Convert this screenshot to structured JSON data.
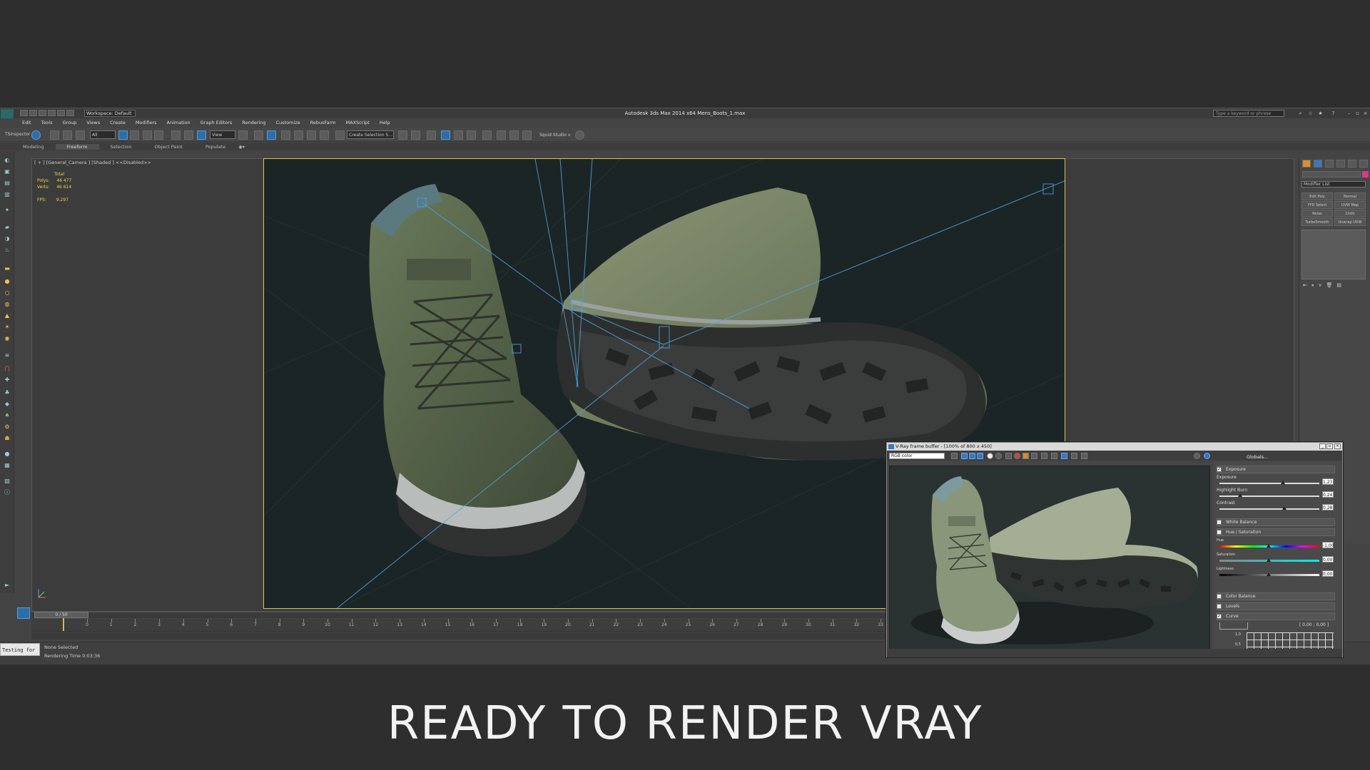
{
  "app": {
    "title": "Autodesk 3ds Max  2014 x64    Mens_Boots_1.max",
    "workspace": "Workspace: Default",
    "search_placeholder": "Type a keyword or phrase",
    "side_label": "TSInspector"
  },
  "menu": [
    "Edit",
    "Tools",
    "Group",
    "Views",
    "Create",
    "Modifiers",
    "Animation",
    "Graph Editors",
    "Rendering",
    "Customize",
    "RebusFarm",
    "MAXScript",
    "Help"
  ],
  "toolbar": {
    "selection_filter": "All",
    "ref_coord": "View",
    "named_selection": "Create Selection S...",
    "plugin_label": "Squid Studio v"
  },
  "ribbon_tabs": [
    "Modeling",
    "Freeform",
    "Selection",
    "Object Paint",
    "Populate"
  ],
  "viewport": {
    "label": "[ + ] [General_Camera ] [Shaded ]  <<Disabled>>",
    "stats_header": "Total",
    "polys_label": "Polys:",
    "polys_value": "46 477",
    "verts_label": "Verts:",
    "verts_value": "46 614",
    "fps_label": "FPS:",
    "fps_value": "9,297"
  },
  "command_panel": {
    "modifier_list": "Modifier List",
    "modifiers": [
      "Edit Poly",
      "Normal",
      "FFD Select",
      "UVW Map",
      "Relax",
      "Cloth",
      "TurboSmooth",
      "Unwrap UVW"
    ]
  },
  "timeline": {
    "frame_indicator": "0 / 50",
    "ticks": [
      "0",
      "1",
      "2",
      "3",
      "4",
      "5",
      "6",
      "7",
      "8",
      "9",
      "10",
      "11",
      "12",
      "13",
      "14",
      "15",
      "16",
      "17",
      "18",
      "19",
      "20",
      "21",
      "22",
      "23",
      "24",
      "25",
      "26",
      "27",
      "28",
      "29",
      "30",
      "31",
      "32",
      "33",
      "34"
    ]
  },
  "status": {
    "maxscript": "Testing for",
    "selection": "None Selected",
    "render_time": "Rendering Time  0:03:36"
  },
  "vfb": {
    "title": "V-Ray frame buffer - [100% of 800 x 450]",
    "channel": "RGB color",
    "globals": "Globals...",
    "exposure_header": "Exposure",
    "exposure_label": "Exposure",
    "exposure_value": "1,23",
    "highlight_label": "Highlight Burn",
    "highlight_value": "0,24",
    "contrast_label": "Contrast",
    "contrast_value": "0,28",
    "white_balance": "White Balance",
    "hue_saturation": "Hue / Saturation",
    "hue_label": "Hue",
    "hue_value": "-1,00",
    "saturation_label": "Saturation",
    "saturation_value": "0,00",
    "lightness_label": "Lightness",
    "lightness_value": "0,00",
    "color_balance": "Color Balance",
    "levels": "Levels",
    "curve": "Curve",
    "curve_coords": "[ 0,00 ; 0,00 ]",
    "curve_y1": "1,0",
    "curve_y2": "0,5"
  },
  "caption": "READY TO RENDER VRAY",
  "colors": {
    "accent_blue": "#2e6ea8",
    "camera_frame": "#d6c64a",
    "boot_green": "#5b6a4d",
    "boot_sole": "#2a2c2b"
  }
}
